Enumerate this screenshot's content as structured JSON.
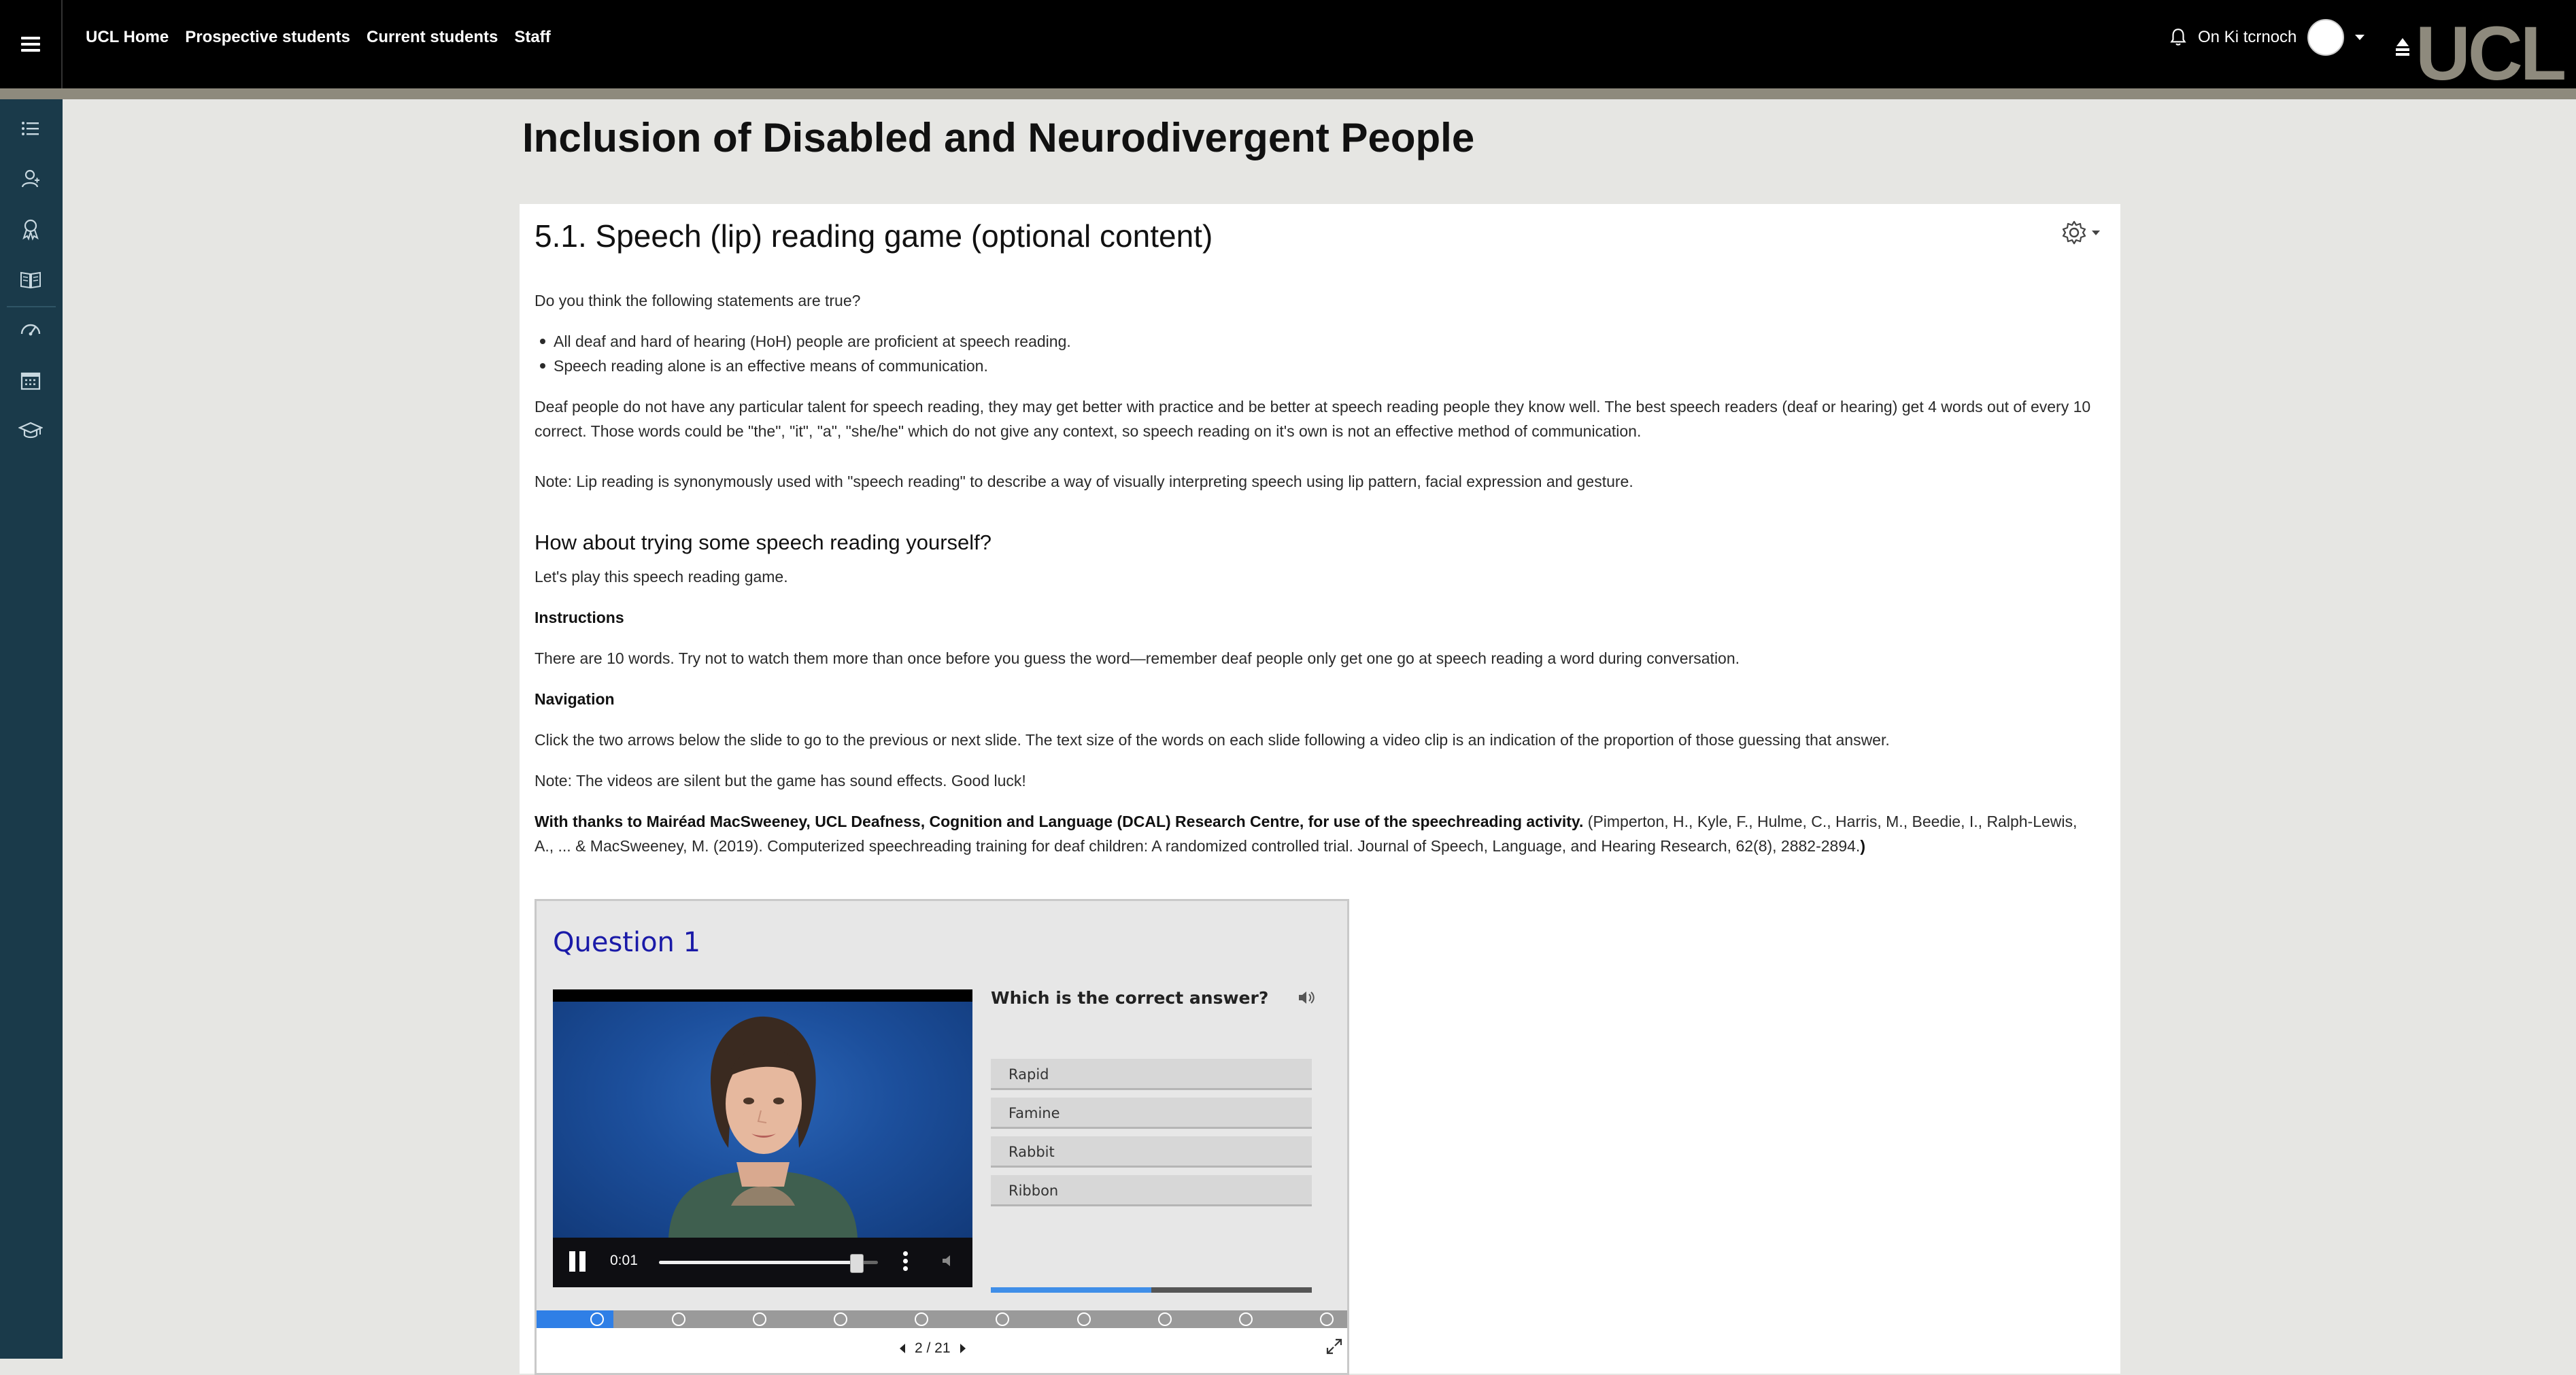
{
  "navbar": {
    "links": [
      "UCL Home",
      "Prospective students",
      "Current students",
      "Staff"
    ],
    "username": "On Ki tcrnoch",
    "logo_text": "UCL"
  },
  "drawer": {
    "icons": [
      "list-icon",
      "participants-icon",
      "badges-icon",
      "book-icon",
      "dashboard-icon",
      "calendar-icon",
      "graduation-cap-icon"
    ]
  },
  "page": {
    "title": "Inclusion of Disabled and Neurodivergent People"
  },
  "section": {
    "title": "5.1. Speech (lip) reading game (optional content)",
    "intro_question": "Do you think the following statements are true?",
    "bullets": [
      "All deaf and hard of hearing (HoH) people are proficient at speech reading.",
      "Speech reading alone is an effective means of communication."
    ],
    "para1": "Deaf people do not have any particular talent for speech reading, they may get better with practice and be better at speech reading people they know well. The best speech readers (deaf or hearing) get 4 words out of every 10 correct. Those words could be \"the\", \"it\", \"a\", \"she/he\" which do not give any context, so speech reading on it's own is not an effective method of communication.",
    "note1": "Note: Lip reading is synonymously used with \"speech reading\" to describe a way of visually interpreting speech using lip pattern, facial expression and gesture.",
    "heading_try": "How about trying some speech reading yourself?",
    "lets_play": "Let's play this speech reading game.",
    "instructions_heading": "Instructions",
    "instructions_text": "There are 10 words. Try not to watch them more than once before you guess the word—remember deaf people only get one go at speech reading a word during conversation.",
    "navigation_heading": "Navigation",
    "navigation_text": "Click the two arrows below the slide to go to the previous or next slide. The text size of the words on each slide following a video clip is an indication of the proportion of those guessing that answer.",
    "note2": "Note: The videos are silent but the game has sound effects. Good luck!",
    "thanks_bold": "With thanks to Mairéad MacSweeney, UCL Deafness, Cognition and Language (DCAL) Research Centre, for use of the speechreading activity.",
    "thanks_citation": "(Pimperton, H., Kyle, F., Hulme, C., Harris, M., Beedie, I., Ralph-Lewis, A., ... & MacSweeney, M. (2019). Computerized speechreading training for deaf children: A randomized controlled trial. Journal of Speech, Language, and Hearing Research, 62(8), 2882-2894.",
    "thanks_close": ")"
  },
  "game": {
    "question_title": "Question 1",
    "video_time": "0:01",
    "video_progress": 0.9,
    "question_text": "Which is the correct answer?",
    "answers": [
      "Rapid",
      "Famine",
      "Rabbit",
      "Ribbon"
    ],
    "question_progress": 0.5,
    "slide_dots": 10,
    "slide_progress": 0.095,
    "pager": "2 / 21",
    "colors": {
      "title": "#1a1aa8",
      "progress": "#2f7fe6"
    }
  }
}
